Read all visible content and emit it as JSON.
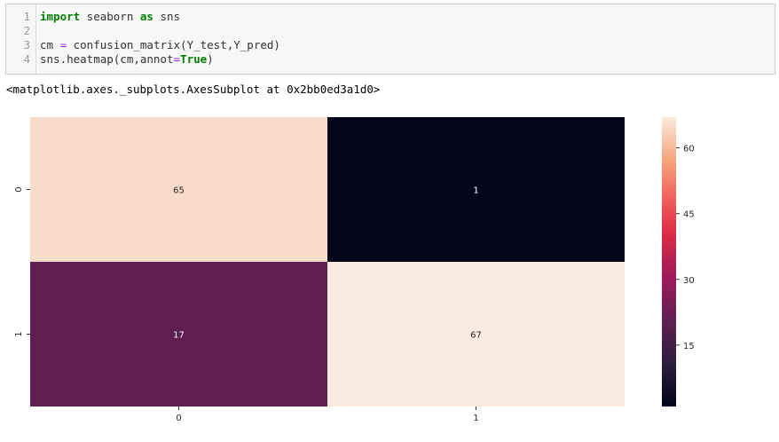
{
  "code_cell": {
    "line_numbers": [
      "1",
      "2",
      "3",
      "4"
    ],
    "lines": {
      "l1": {
        "import_kw": "import",
        "module": " seaborn ",
        "as_kw": "as",
        "alias": " sns"
      },
      "l3": {
        "lhs": "cm ",
        "eq": "=",
        "rhs": " confusion_matrix(Y_test,Y_pred)"
      },
      "l4": {
        "call": "sns.heatmap(cm,annot",
        "eq": "=",
        "true_kw": "True",
        "close": ")"
      }
    }
  },
  "output": {
    "repr": "<matplotlib.axes._subplots.AxesSubplot at 0x2bb0ed3a1d0>"
  },
  "chart_data": {
    "type": "heatmap",
    "rows": [
      "0",
      "1"
    ],
    "columns": [
      "0",
      "1"
    ],
    "values": [
      [
        65,
        1
      ],
      [
        17,
        67
      ]
    ],
    "annotations": true,
    "colormap": "rocket",
    "cell_colors": [
      [
        "#f7dccb",
        "#03051a"
      ],
      [
        "#5e1f50",
        "#faeadd"
      ]
    ],
    "colorbar": {
      "ticks": [
        "15",
        "30",
        "45",
        "60"
      ],
      "range": [
        1,
        67
      ]
    }
  }
}
